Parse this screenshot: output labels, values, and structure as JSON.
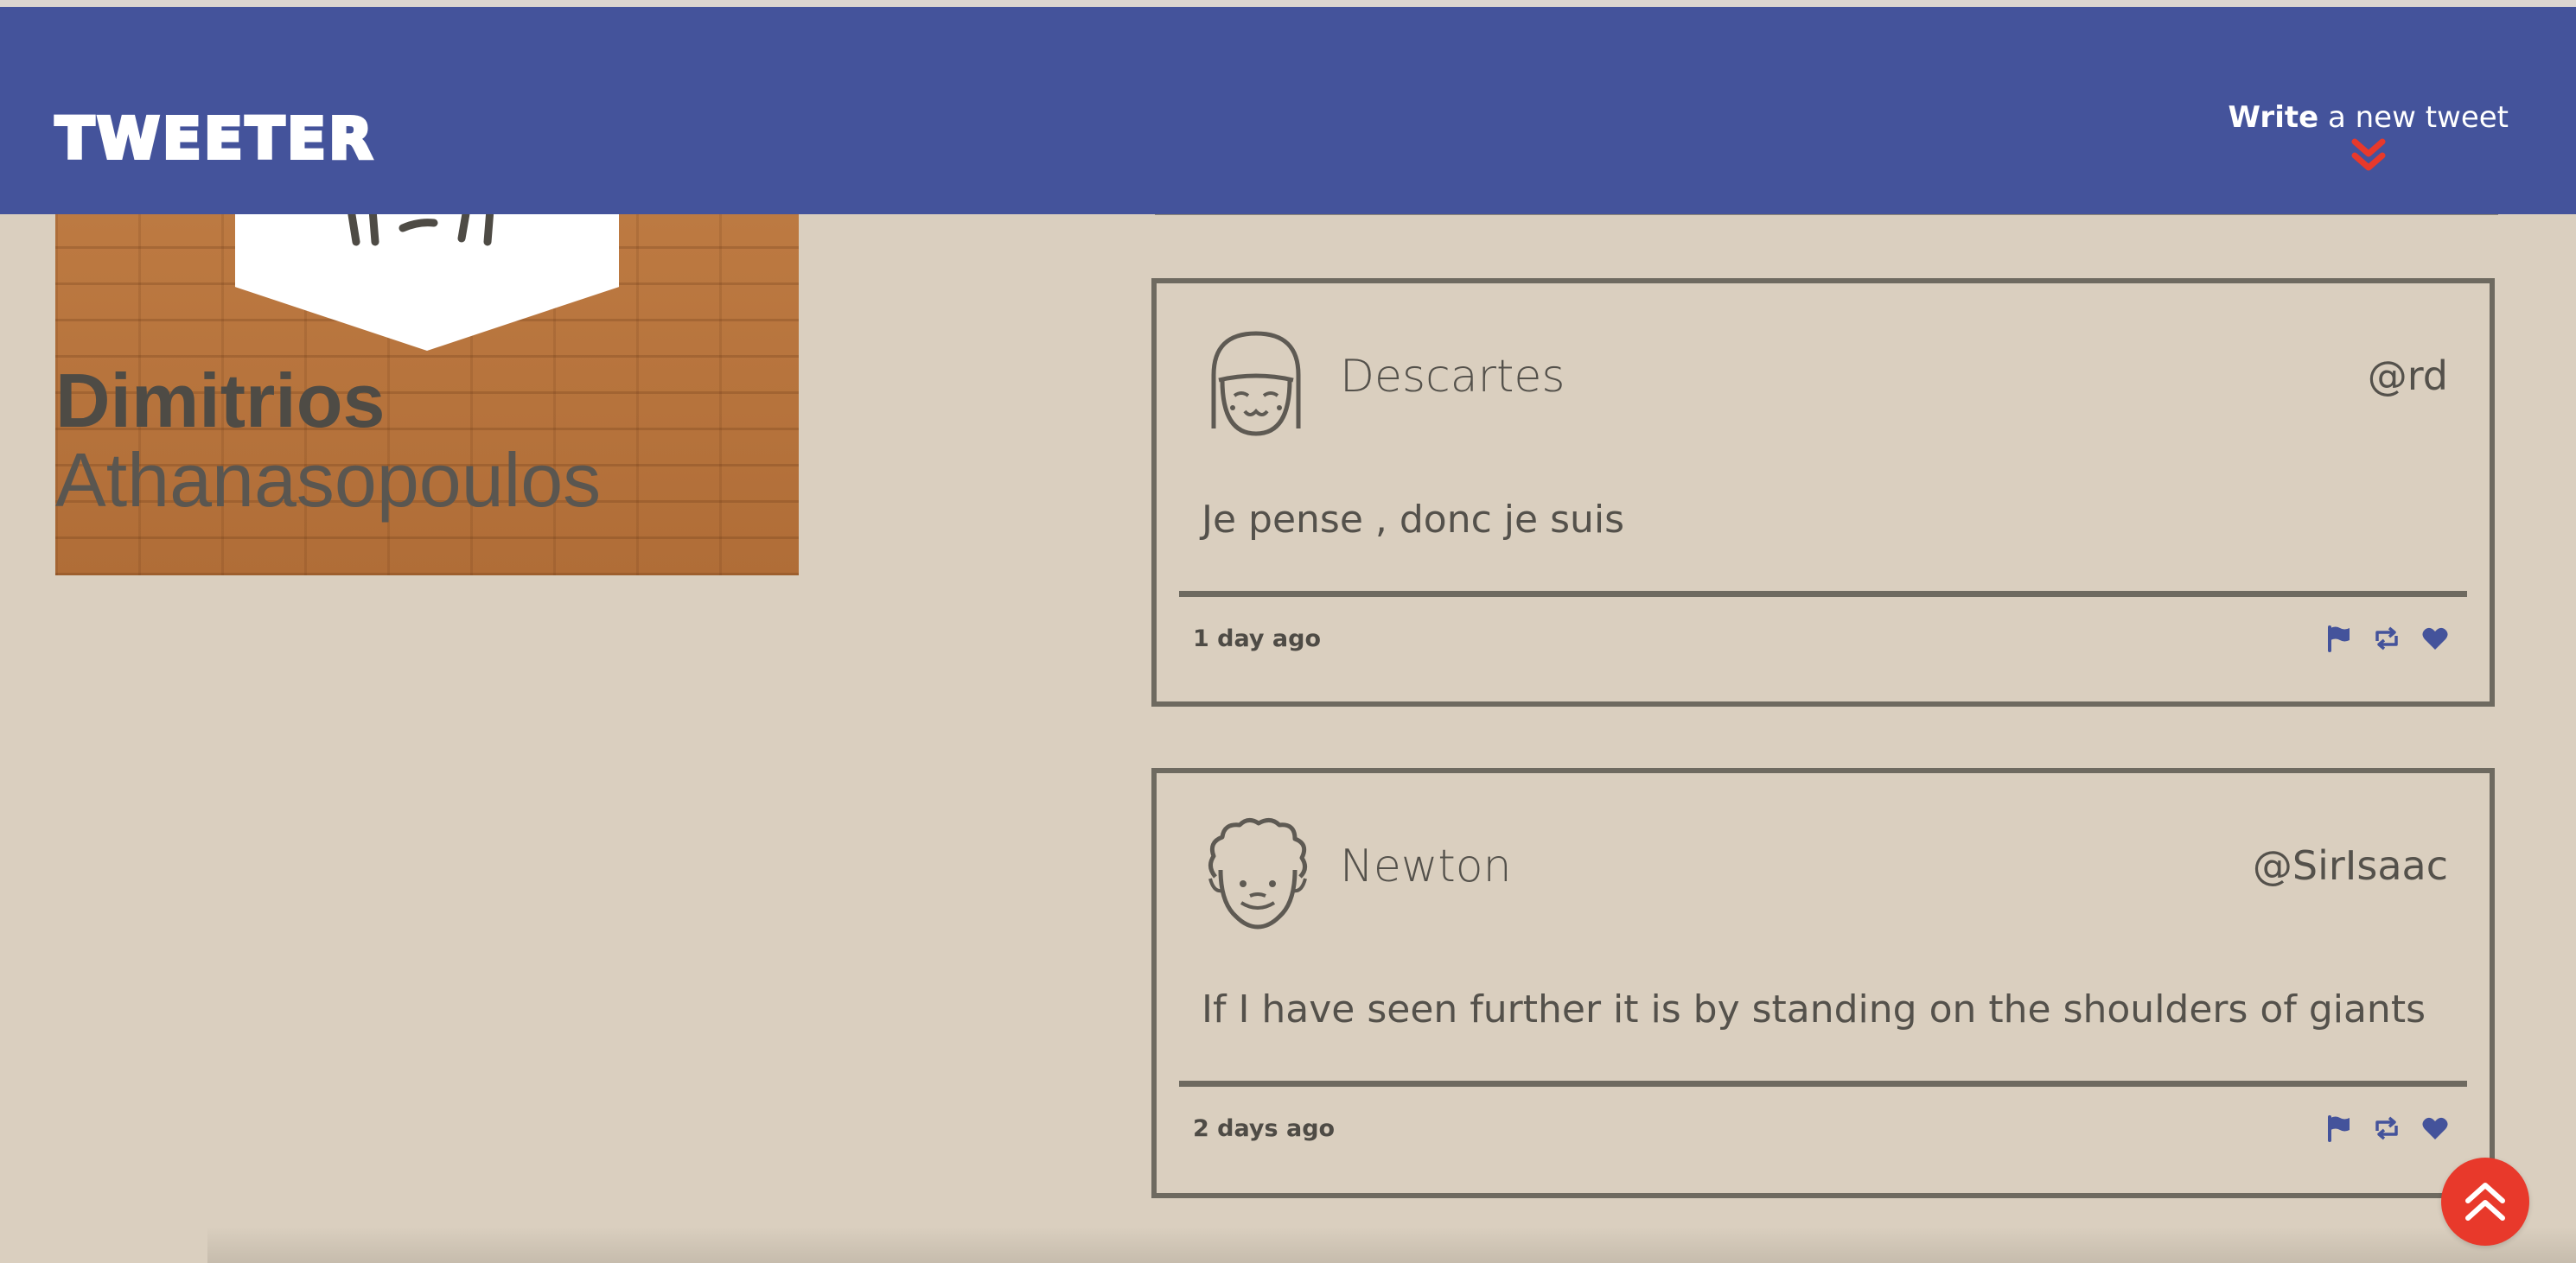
{
  "header": {
    "logo": "TWEETER",
    "compose_bold": "Write",
    "compose_rest": " a new tweet"
  },
  "profile": {
    "first_name": "Dimitrios",
    "last_name": "Athanasopoulos"
  },
  "tweets": [
    {
      "name": "Descartes",
      "handle": "@rd",
      "text": "Je pense , donc je suis",
      "time": "1 day ago",
      "avatar": "girl-face-avatar"
    },
    {
      "name": "Newton",
      "handle": "@SirIsaac",
      "text": "If I have seen further it is by standing on the shoulders of giants",
      "time": "2 days ago",
      "avatar": "curly-hair-face-avatar"
    }
  ],
  "icons": {
    "actions": [
      "flag-icon",
      "retweet-icon",
      "heart-icon"
    ],
    "compose": "double-chevron-down-icon",
    "scroll_top": "double-chevron-up-icon"
  },
  "colors": {
    "header": "#44539b",
    "background": "#dacfbf",
    "accent_red": "#e8392b",
    "icon_blue": "#44539b",
    "text": "#54514b"
  }
}
